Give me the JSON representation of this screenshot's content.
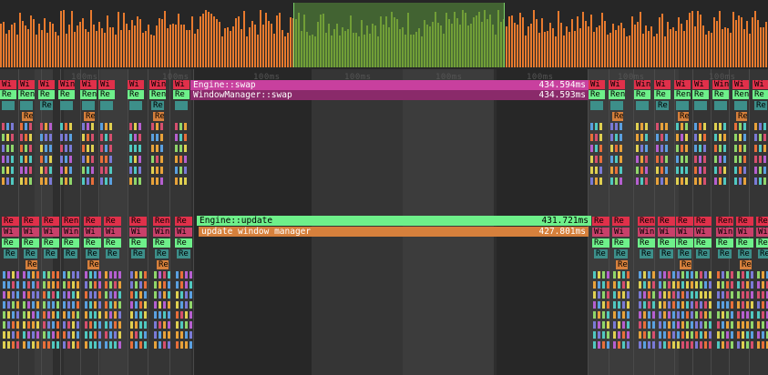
{
  "timeline": {
    "tick_labels": [
      "100ms",
      "100ms",
      "100ms",
      "100ms",
      "100ms",
      "100ms",
      "100ms",
      "100ms"
    ]
  },
  "events": {
    "engine_swap": {
      "label": "Engine::swap",
      "duration": "434.594ms",
      "color": "#c8409e"
    },
    "window_manager_swap": {
      "label": "WindowManager::swap",
      "duration": "434.593ms",
      "color": "#8a2a6a"
    },
    "engine_update": {
      "label": "Engine::update",
      "duration": "431.721ms",
      "color": "#6ef08a"
    },
    "update_window_manager": {
      "label": "update window manager",
      "duration": "427.801ms",
      "color": "#d6803c"
    }
  },
  "short_labels": {
    "wi": "Wi",
    "win": "Win",
    "re": "Re",
    "ren": "Ren"
  },
  "colors": {
    "histogram_bar": "#e87a2e",
    "histogram_selected": "#8fa832",
    "selection": "#5a963c"
  }
}
